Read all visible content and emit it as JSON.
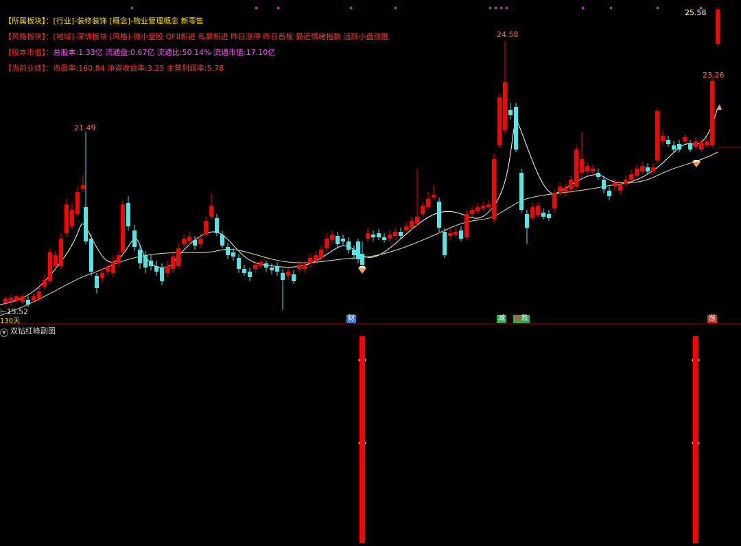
{
  "info": [
    {
      "label": "【所属板块】：",
      "text": "[行业]-装修装饰 [概念]-物业管理概念 新零售",
      "label_color": "yellow",
      "text_color": "yellow"
    },
    {
      "label": "【风格板块】：",
      "text": "[地域]-深圳板块 [风格]-微小盘股 QFII新进 私募新进 昨日涨停 昨日首板 最近情绪指数 活跃小盘涨融",
      "label_color": "red",
      "text_color": "red"
    },
    {
      "label": "【股本市值】：",
      "text": "总股本:1.33亿 流通盘:0.67亿 流通比:50.14% 流通市值:17.10亿",
      "label_color": "magenta",
      "text_color": "magenta"
    },
    {
      "label": "【当前业绩】：",
      "text": "市盈率:160.84 净资收益率:3.25 主营利润率:5.78",
      "label_color": "red",
      "text_color": "red"
    }
  ],
  "price_labels": {
    "high_right": "25.58",
    "peak_mid": "24.58",
    "peak_left": "21.49",
    "last": "23.26",
    "low_left": "15.52"
  },
  "period_label": "130天",
  "badges": [
    {
      "text": "财",
      "color": "#3a7bd5"
    },
    {
      "text": "减",
      "color": "#2fa84f"
    },
    {
      "text": "跌",
      "color": "#2fa84f"
    },
    {
      "text": "涨",
      "color": "#c0392b"
    }
  ],
  "sub_chart_title": "双钻红峰副图",
  "colors": {
    "up": "#ff0000",
    "down": "#4fe8e8",
    "ma_short": "#ffffff",
    "ma_long": "#e6e08a",
    "axis": "#aa0000"
  },
  "icons": {
    "collapse": "chevron-down-icon",
    "diamond": "diamond-icon"
  }
}
